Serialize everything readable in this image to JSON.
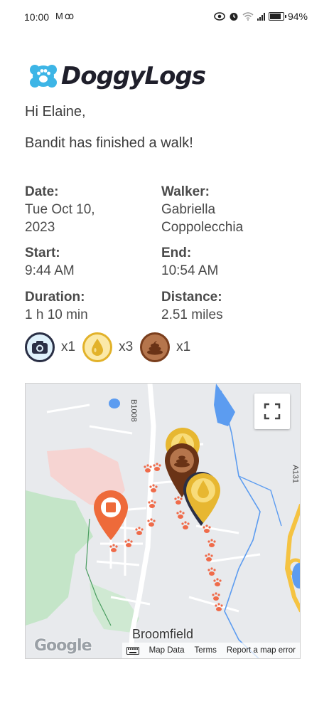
{
  "status_bar": {
    "time": "10:00",
    "left_icons": [
      "mail-icon",
      "voicemail-icon"
    ],
    "right_icons": [
      "eye-icon",
      "alarm-icon",
      "wifi-icon",
      "signal-icon",
      "battery-icon"
    ],
    "battery_percent": "94%",
    "battery_level": 0.94
  },
  "brand": {
    "name": "DoggyLogs",
    "icon": "paw-icon",
    "icon_color": "#3db5e6"
  },
  "email": {
    "greeting": "Hi Elaine,",
    "message": "Bandit has finished a walk!"
  },
  "details": {
    "date_label": "Date:",
    "date_line1": "Tue Oct 10,",
    "date_line2": "2023",
    "walker_label": "Walker:",
    "walker_line1": "Gabriella",
    "walker_line2": "Coppolecchia",
    "start_label": "Start:",
    "start_value": "9:44 AM",
    "end_label": "End:",
    "end_value": "10:54 AM",
    "duration_label": "Duration:",
    "duration_value": "1 h 10 min",
    "distance_label": "Distance:",
    "distance_value": "2.51 miles"
  },
  "counters": [
    {
      "icon": "camera-icon",
      "count": "x1",
      "color": "#2a2f45"
    },
    {
      "icon": "pee-icon",
      "count": "x3",
      "color": "#e2b22a"
    },
    {
      "icon": "poop-icon",
      "count": "x1",
      "color": "#7a3e1d"
    }
  ],
  "map": {
    "town_label": "Broomfield",
    "road_label_1": "B1008",
    "road_label_2": "A131",
    "google_label": "Google",
    "footer": {
      "map_data": "Map Data",
      "terms": "Terms",
      "report": "Report a map error"
    },
    "colors": {
      "route": "#ef6b4a",
      "start_marker": "#ee6a3a",
      "water": "#5c9cf0",
      "park": "#c4e5c8",
      "residential": "#f6d4d2",
      "major_road": "#f5c342"
    }
  }
}
